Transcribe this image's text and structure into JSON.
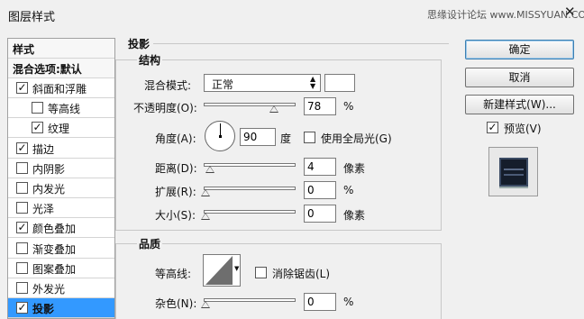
{
  "window": {
    "title": "图层样式",
    "watermark": "思缘设计论坛 www.MISSYUAN.COM",
    "close_glyph": "✕"
  },
  "sidebar": {
    "header": "样式",
    "blend_options": "混合选项:默认",
    "items": [
      {
        "label": "斜面和浮雕",
        "checked": true,
        "indent": false,
        "selected": false
      },
      {
        "label": "等高线",
        "checked": false,
        "indent": true,
        "selected": false
      },
      {
        "label": "纹理",
        "checked": true,
        "indent": true,
        "selected": false
      },
      {
        "label": "描边",
        "checked": true,
        "indent": false,
        "selected": false
      },
      {
        "label": "内阴影",
        "checked": false,
        "indent": false,
        "selected": false
      },
      {
        "label": "内发光",
        "checked": false,
        "indent": false,
        "selected": false
      },
      {
        "label": "光泽",
        "checked": false,
        "indent": false,
        "selected": false
      },
      {
        "label": "颜色叠加",
        "checked": true,
        "indent": false,
        "selected": false
      },
      {
        "label": "渐变叠加",
        "checked": false,
        "indent": false,
        "selected": false
      },
      {
        "label": "图案叠加",
        "checked": false,
        "indent": false,
        "selected": false
      },
      {
        "label": "外发光",
        "checked": false,
        "indent": false,
        "selected": false
      },
      {
        "label": "投影",
        "checked": true,
        "indent": false,
        "selected": true
      }
    ],
    "selected_color": "#3399ff"
  },
  "panel": {
    "title": "投影",
    "structure": {
      "title": "结构",
      "blend_mode_label": "混合模式:",
      "blend_mode_value": "正常",
      "blend_color": "#ffffff",
      "opacity_label": "不透明度(O):",
      "opacity_value": "78",
      "opacity_fraction": 0.78,
      "opacity_unit": "%",
      "angle_label": "角度(A):",
      "angle_value": "90",
      "angle_unit": "度",
      "global_light_label": "使用全局光(G)",
      "global_light_checked": false,
      "distance_label": "距离(D):",
      "distance_value": "4",
      "distance_unit": "像素",
      "spread_label": "扩展(R):",
      "spread_value": "0",
      "spread_unit": "%",
      "size_label": "大小(S):",
      "size_value": "0",
      "size_unit": "像素"
    },
    "quality": {
      "title": "品质",
      "contour_label": "等高线:",
      "antialias_label": "消除锯齿(L)",
      "antialias_checked": false,
      "noise_label": "杂色(N):",
      "noise_value": "0",
      "noise_unit": "%"
    }
  },
  "buttons": {
    "ok": "确定",
    "cancel": "取消",
    "new_style": "新建样式(W)...",
    "preview_label": "预览(V)",
    "preview_checked": true
  }
}
